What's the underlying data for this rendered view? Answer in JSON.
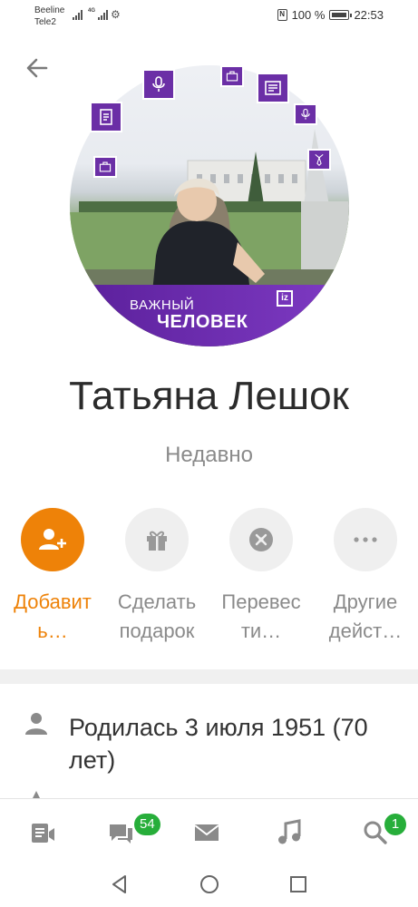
{
  "status_bar": {
    "carrier1": "Beeline",
    "carrier2": "Tele2",
    "network": "4G",
    "battery": "100 %",
    "time": "22:53"
  },
  "avatar": {
    "banner_line1": "ВАЖНЫЙ",
    "banner_line2": "ЧЕЛОВЕК",
    "logo": "iz",
    "accent_color": "#6b2fa6"
  },
  "profile": {
    "name": "Татьяна Лешок",
    "last_seen": "Недавно"
  },
  "actions": [
    {
      "label": "Добавит\nь…",
      "icon": "add-friend-icon",
      "primary": true
    },
    {
      "label": "Сделать\nподарок",
      "icon": "gift-icon",
      "primary": false
    },
    {
      "label": "Перевес\nти…",
      "icon": "money-transfer-icon",
      "primary": false
    },
    {
      "label": "Другие\nдейст…",
      "icon": "more-icon",
      "primary": false
    }
  ],
  "info": {
    "birth": "Родилась 3 июля 1951 (70 лет)"
  },
  "tabbar": {
    "messages_badge": "54",
    "discussions_badge": "1"
  },
  "colors": {
    "primary": "#ee8208",
    "badge": "#27ae3a"
  }
}
